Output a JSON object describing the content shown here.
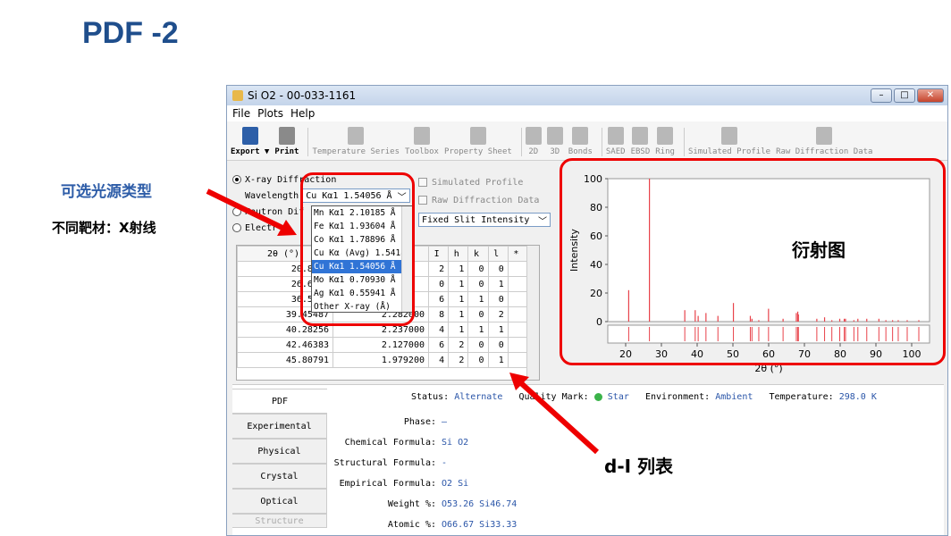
{
  "slide": {
    "title": "PDF -2",
    "ann_source": "可选光源类型",
    "ann_target": "不同靶材：X射线",
    "ann_diff": "衍射图",
    "ann_dl": "d-I 列表"
  },
  "window": {
    "title": "Si O2 - 00-033-1161",
    "menu": [
      "File",
      "Plots",
      "Help"
    ],
    "toolbar": [
      "Export ▼",
      "Print",
      "Temperature Series",
      "Toolbox",
      "Property Sheet",
      "2D",
      "3D",
      "Bonds",
      "SAED",
      "EBSD",
      "Ring",
      "Simulated Profile",
      "Raw Diffraction Data"
    ]
  },
  "left": {
    "xray_label": "X-ray Diffraction",
    "neutron_label": "Neutron Dif",
    "electron_label": "Electr",
    "wavelength_label": "Wavelength",
    "wavelength_value": "Cu Kα1 1.54056 Å",
    "dropdown_options": [
      "Mn Kα1 2.10185 Å",
      "Fe Kα1 1.93604 Å",
      "Co Kα1 1.78896 Å",
      "Cu Kα (Avg) 1.5418",
      "Cu Kα1 1.54056 Å",
      "Mo Kα1 0.70930 Å",
      "Ag Kα1 0.55941 Å",
      "Other X-ray (Å)"
    ],
    "selected_index": 4
  },
  "options": {
    "sim_profile": "Simulated Profile",
    "raw_data": "Raw Diffraction Data",
    "slit": "Fixed Slit Intensity"
  },
  "table": {
    "headers": [
      "2θ (°)",
      "d (Å)",
      "I",
      "h",
      "k",
      "l",
      "*"
    ],
    "rows": [
      [
        "20.8495",
        "",
        "2",
        "1",
        "0",
        "0",
        ""
      ],
      [
        "26.6512",
        "",
        "0",
        "1",
        "0",
        "1",
        ""
      ],
      [
        "36.5410",
        "",
        "6",
        "1",
        "1",
        "0",
        ""
      ],
      [
        "39.45487",
        "2.282000",
        "8",
        "1",
        "0",
        "2",
        ""
      ],
      [
        "40.28256",
        "2.237000",
        "4",
        "1",
        "1",
        "1",
        ""
      ],
      [
        "42.46383",
        "2.127000",
        "6",
        "2",
        "0",
        "0",
        ""
      ],
      [
        "45.80791",
        "1.979200",
        "4",
        "2",
        "0",
        "1",
        ""
      ]
    ]
  },
  "chart_data": {
    "type": "bar",
    "xlabel": "2θ (°)",
    "ylabel": "Intensity",
    "xlim": [
      15,
      105
    ],
    "ylim": [
      0,
      100
    ],
    "xticks": [
      20,
      30,
      40,
      50,
      60,
      70,
      80,
      90,
      100
    ],
    "yticks": [
      0,
      20,
      40,
      60,
      80,
      100
    ],
    "x": [
      20.85,
      26.65,
      36.54,
      39.45,
      40.28,
      42.46,
      45.81,
      50.14,
      54.87,
      55.33,
      57.24,
      59.96,
      64.03,
      67.74,
      68.14,
      68.32,
      73.47,
      75.64,
      77.67,
      79.88,
      81.14,
      81.49,
      83.84,
      84.95,
      87.44,
      90.83,
      92.79,
      94.66,
      96.24,
      98.75,
      102.0
    ],
    "y": [
      22,
      100,
      8,
      8,
      4,
      6,
      4,
      13,
      4,
      2,
      1,
      9,
      2,
      6,
      7,
      5,
      2,
      3,
      1,
      2,
      2,
      2,
      1,
      2,
      2,
      2,
      1,
      1,
      1,
      1,
      1
    ],
    "color": "#e8424a"
  },
  "bottom": {
    "tabs": [
      "PDF",
      "Experimental",
      "Physical",
      "Crystal",
      "Optical",
      "Structure"
    ],
    "status_label": "Status:",
    "status_value": "Alternate",
    "quality_label": "Quality Mark:",
    "quality_value": "Star",
    "env_label": "Environment:",
    "env_value": "Ambient",
    "temp_label": "Temperature:",
    "temp_value": "298.0 K",
    "props": [
      {
        "k": "Phase:",
        "v": "–"
      },
      {
        "k": "Chemical Formula:",
        "v": "Si O2"
      },
      {
        "k": "Structural Formula:",
        "v": "-"
      },
      {
        "k": "Empirical Formula:",
        "v": "O2 Si"
      },
      {
        "k": "Weight %:",
        "v": "O53.26 Si46.74"
      },
      {
        "k": "Atomic %:",
        "v": "O66.67 Si33.33"
      }
    ]
  }
}
